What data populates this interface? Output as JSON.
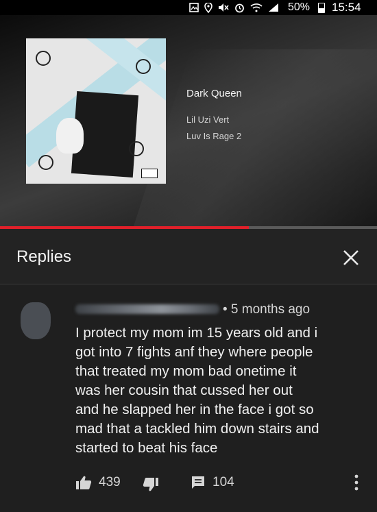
{
  "status_bar": {
    "icons": [
      "image-icon",
      "location-icon",
      "mute-icon",
      "alarm-icon",
      "wifi-icon",
      "signal-icon"
    ],
    "battery": "50%",
    "time": "15:54"
  },
  "now_playing": {
    "title": "Dark Queen",
    "artist": "Lil Uzi Vert",
    "album": "Luv Is Rage 2",
    "progress": 0.66,
    "progress_color": "#e0202a"
  },
  "replies": {
    "title": "Replies",
    "close_icon": "close-icon"
  },
  "comment": {
    "time_ago": "• 5 months ago",
    "body_lines": [
      "I protect my mom im 15 years old and i",
      "got into 7 fights anf they where people",
      "that treated my mom bad onetime it",
      "was her cousin that cussed her out",
      "and he slapped her in the face i got so",
      "mad that a tackled him down stairs and",
      "started to beat his face"
    ],
    "likes": "439",
    "replies_count": "104",
    "icons": {
      "like": "thumbs-up-icon",
      "dislike": "thumbs-down-icon",
      "reply": "comment-icon",
      "more": "more-vertical-icon"
    }
  }
}
